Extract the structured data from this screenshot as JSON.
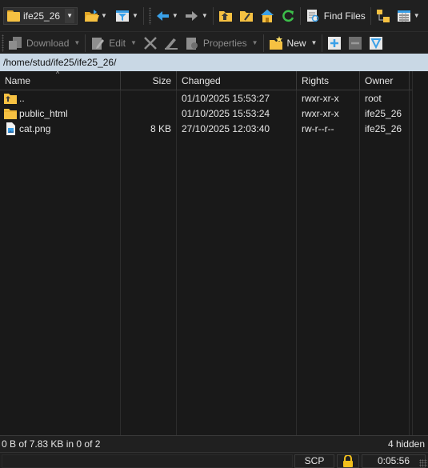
{
  "toolbar1": {
    "session_name": "ife25_26",
    "find_files_label": "Find Files"
  },
  "toolbar2": {
    "download_label": "Download",
    "edit_label": "Edit",
    "properties_label": "Properties",
    "new_label": "New"
  },
  "path": "/home/stud/ife25/ife25_26/",
  "columns": {
    "name": "Name",
    "size": "Size",
    "changed": "Changed",
    "rights": "Rights",
    "owner": "Owner"
  },
  "files": [
    {
      "name": "..",
      "size": "",
      "changed": "01/10/2025 15:53:27",
      "rights": "rwxr-xr-x",
      "owner": "root",
      "icon": "parent-folder-icon"
    },
    {
      "name": "public_html",
      "size": "",
      "changed": "01/10/2025 15:53:24",
      "rights": "rwxr-xr-x",
      "owner": "ife25_26",
      "icon": "folder-icon"
    },
    {
      "name": "cat.png",
      "size": "8 KB",
      "changed": "27/10/2025 12:03:40",
      "rights": "rw-r--r--",
      "owner": "ife25_26",
      "icon": "image-file-icon"
    }
  ],
  "status": {
    "selection": "0 B of 7.83 KB in 0 of 2",
    "hidden": "4 hidden"
  },
  "bottom": {
    "protocol": "SCP",
    "elapsed": "0:05:56"
  },
  "colors": {
    "background": "#191919",
    "toolbar": "#202020",
    "path_bar": "#c9d8e5",
    "accent_blue": "#3aa0e8",
    "folder": "#f6c142",
    "refresh_green": "#3cbf4a",
    "lock": "#f3c01c"
  }
}
